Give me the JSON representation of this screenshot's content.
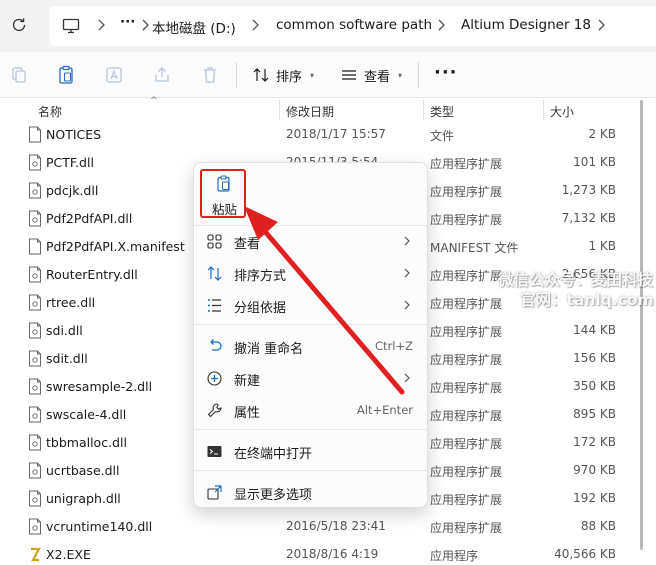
{
  "address": {
    "segments": [
      "本地磁盘 (D:)",
      "common software path",
      "Altium Designer 18"
    ],
    "ellipsis": "···"
  },
  "toolbar": {
    "sort_label": "排序",
    "view_label": "查看",
    "more_label": "···"
  },
  "columns": {
    "name": "名称",
    "date": "修改日期",
    "type": "类型",
    "size": "大小"
  },
  "files": [
    {
      "name": "NOTICES",
      "date": "2018/1/17 15:57",
      "type": "文件",
      "size": "2 KB",
      "icon": "file-icon"
    },
    {
      "name": "PCTF.dll",
      "date": "2015/11/3 5:54",
      "type": "应用程序扩展",
      "size": "101 KB",
      "icon": "dll-icon"
    },
    {
      "name": "pdcjk.dll",
      "date": "",
      "type": "应用程序扩展",
      "size": "1,273 KB",
      "icon": "dll-icon"
    },
    {
      "name": "Pdf2PdfAPI.dll",
      "date": "",
      "type": "应用程序扩展",
      "size": "7,132 KB",
      "icon": "dll-icon"
    },
    {
      "name": "Pdf2PdfAPI.X.manifest",
      "date": "",
      "type": "MANIFEST 文件",
      "size": "1 KB",
      "icon": "file-icon"
    },
    {
      "name": "RouterEntry.dll",
      "date": "",
      "type": "应用程序扩展",
      "size": "2,656 KB",
      "icon": "dll-icon"
    },
    {
      "name": "rtree.dll",
      "date": "",
      "type": "应用程序扩展",
      "size": "",
      "icon": "dll-icon"
    },
    {
      "name": "sdi.dll",
      "date": "",
      "type": "应用程序扩展",
      "size": "144 KB",
      "icon": "dll-icon"
    },
    {
      "name": "sdit.dll",
      "date": "",
      "type": "应用程序扩展",
      "size": "156 KB",
      "icon": "dll-icon"
    },
    {
      "name": "swresample-2.dll",
      "date": "",
      "type": "应用程序扩展",
      "size": "350 KB",
      "icon": "dll-icon"
    },
    {
      "name": "swscale-4.dll",
      "date": "",
      "type": "应用程序扩展",
      "size": "895 KB",
      "icon": "dll-icon"
    },
    {
      "name": "tbbmalloc.dll",
      "date": "",
      "type": "应用程序扩展",
      "size": "172 KB",
      "icon": "dll-icon"
    },
    {
      "name": "ucrtbase.dll",
      "date": "",
      "type": "应用程序扩展",
      "size": "970 KB",
      "icon": "dll-icon"
    },
    {
      "name": "unigraph.dll",
      "date": "",
      "type": "应用程序扩展",
      "size": "192 KB",
      "icon": "dll-icon"
    },
    {
      "name": "vcruntime140.dll",
      "date": "2016/5/18 23:41",
      "type": "应用程序扩展",
      "size": "88 KB",
      "icon": "dll-icon"
    },
    {
      "name": "X2.EXE",
      "date": "2018/8/16 4:19",
      "type": "应用程序",
      "size": "40,566 KB",
      "icon": "exe-icon"
    }
  ],
  "context_menu": {
    "paste": "粘贴",
    "items": [
      {
        "label": "查看",
        "shortcut": "",
        "icon": "grid-icon",
        "submenu": true
      },
      {
        "label": "排序方式",
        "shortcut": "",
        "icon": "sort-icon",
        "submenu": true
      },
      {
        "label": "分组依据",
        "shortcut": "",
        "icon": "group-icon",
        "submenu": true
      },
      {
        "label": "撤消 重命名",
        "shortcut": "Ctrl+Z",
        "icon": "undo-icon",
        "submenu": false
      },
      {
        "label": "新建",
        "shortcut": "",
        "icon": "new-icon",
        "submenu": true
      },
      {
        "label": "属性",
        "shortcut": "Alt+Enter",
        "icon": "wrench-icon",
        "submenu": false
      },
      {
        "label": "在终端中打开",
        "shortcut": "",
        "icon": "terminal-icon",
        "submenu": false
      },
      {
        "label": "显示更多选项",
        "shortcut": "",
        "icon": "more-options-icon",
        "submenu": false
      }
    ]
  },
  "watermark": {
    "line1": "微信公众号：麦田科技",
    "line2": "官网：tanlq.com"
  },
  "colors": {
    "annotation_red": "#e02020",
    "accent_blue": "#1a6fc9"
  }
}
